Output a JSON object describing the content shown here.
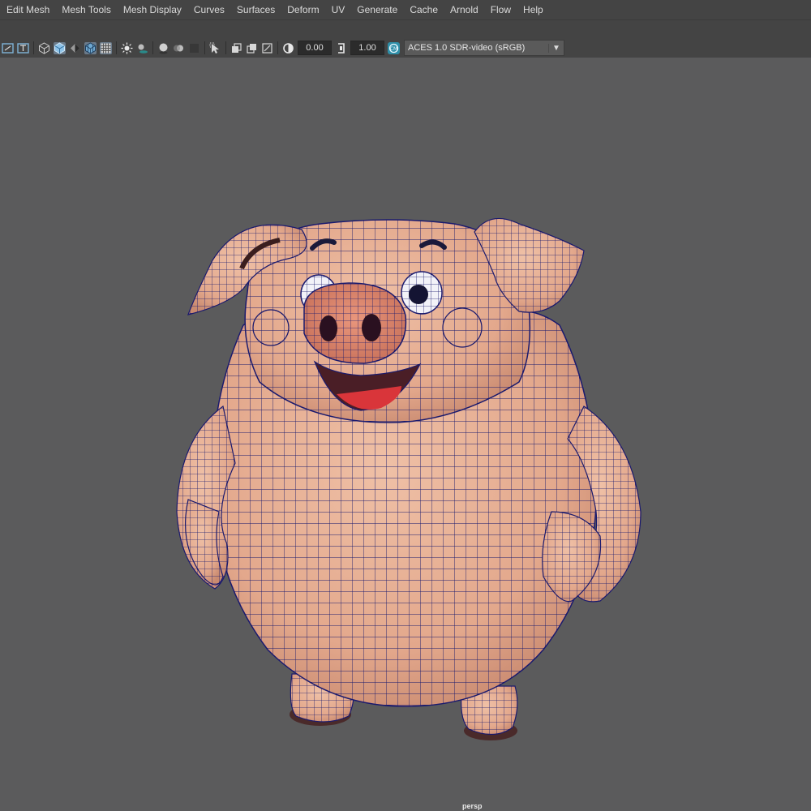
{
  "menu": [
    "Edit Mesh",
    "Mesh Tools",
    "Mesh Display",
    "Curves",
    "Surfaces",
    "Deform",
    "UV",
    "Generate",
    "Cache",
    "Arnold",
    "Flow",
    "Help"
  ],
  "toolbar": {
    "exposure_value": "0.00",
    "gamma_value": "1.00",
    "color_management": "ACES 1.0 SDR-video (sRGB)",
    "icons": [
      "frame-selected-icon",
      "film-gate-icon",
      "resolution-gate-icon",
      "wireframe-icon",
      "smooth-shade-icon",
      "default-material-icon",
      "wireframe-on-shaded-icon",
      "xray-icon",
      "use-all-lights-icon",
      "shadows-icon",
      "screen-space-ao-icon",
      "motion-blur-icon",
      "anti-aliasing-icon",
      "depth-of-field-icon",
      "isolate-select-icon",
      "xray-joints-icon",
      "xray-active-icon",
      "backface-culling-icon",
      "exposure-icon",
      "gamma-icon",
      "color-management-toggle-icon"
    ]
  },
  "viewport": {
    "camera": "persp",
    "background_color": "#5b5b5c",
    "model": "pig-character-wireframe-on-shaded",
    "skin_color": "#e3a88c",
    "wire_color": "#1a1a6e"
  }
}
